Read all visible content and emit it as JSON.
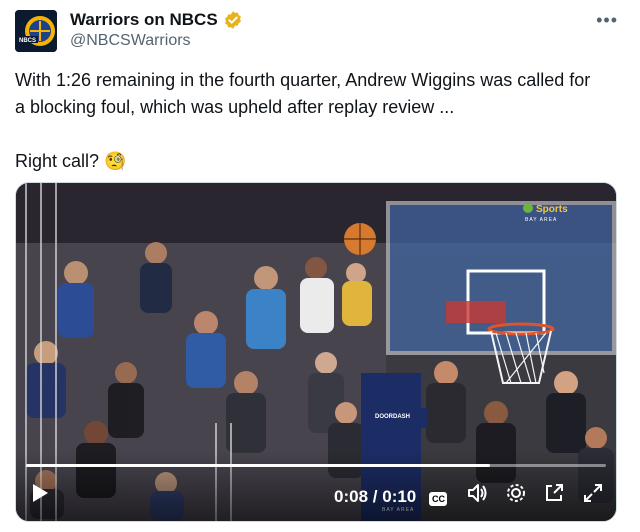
{
  "account": {
    "name": "Warriors on NBCS",
    "handle": "@NBCSWarriors",
    "avatar_text": "NBCS",
    "verified_color": "#e8b21a"
  },
  "tweet": {
    "text_line1": "With 1:26 remaining in the fourth quarter, Andrew Wiggins was called for",
    "text_line2": "a blocking foul, which was upheld after replay review ...",
    "question": "Right call?",
    "emoji": "🧐"
  },
  "video": {
    "current_time": "0:08",
    "separator": "/",
    "duration": "0:10",
    "progress": 0.8,
    "sponsor_banner": "DOORDASH",
    "broadcast_bug": "BAY AREA",
    "cc_label": "CC",
    "icons": [
      "play-icon",
      "captions-icon",
      "volume-icon",
      "settings-icon",
      "popout-icon",
      "fullscreen-icon"
    ]
  }
}
